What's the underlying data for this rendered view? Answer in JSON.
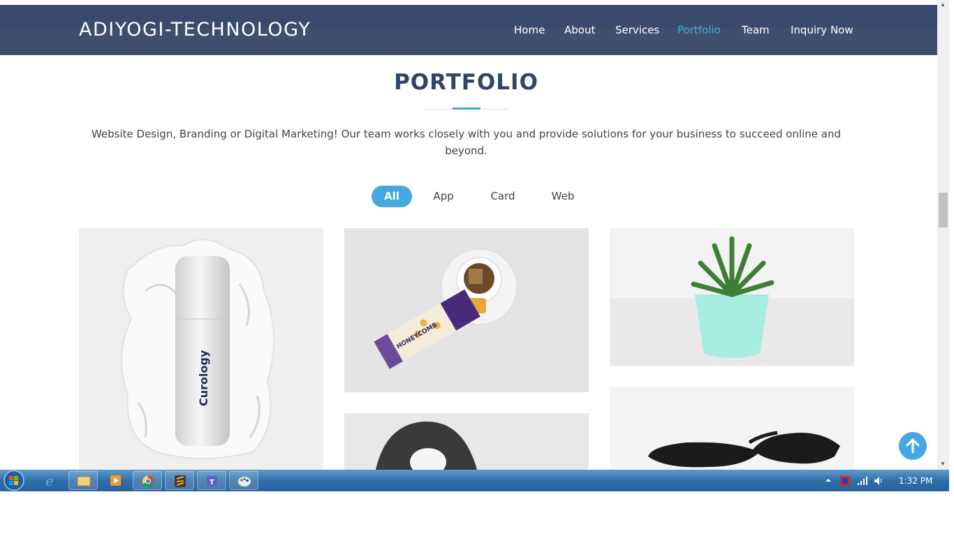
{
  "brand": "ADIYOGI-TECHNOLOGY",
  "nav": [
    {
      "label": "Home",
      "active": false
    },
    {
      "label": "About",
      "active": false
    },
    {
      "label": "Services",
      "active": false
    },
    {
      "label": "Portfolio",
      "active": true
    },
    {
      "label": "Team",
      "active": false
    },
    {
      "label": "Inquiry Now",
      "active": false
    }
  ],
  "section": {
    "title": "PORTFOLIO",
    "description": "Website Design, Branding or Digital Marketing! Our team works closely with you and provide solutions for your business to succeed online and beyond."
  },
  "filters": [
    {
      "label": "All",
      "active": true
    },
    {
      "label": "App",
      "active": false
    },
    {
      "label": "Card",
      "active": false
    },
    {
      "label": "Web",
      "active": false
    }
  ],
  "portfolio_items": [
    {
      "icon": "skincare-bottle-image",
      "text": "Curology"
    },
    {
      "icon": "honeycomb-tea-image",
      "text": "HONEYCOMB"
    },
    {
      "icon": "succulent-plant-image"
    },
    {
      "icon": "lamp-image"
    },
    {
      "icon": "sunglasses-image"
    }
  ],
  "colors": {
    "header": "#3f506f",
    "accent": "#46a8e0",
    "title": "#2f4468"
  },
  "taskbar": {
    "clock": "1:32 PM",
    "apps": [
      "start-orb-icon",
      "internet-explorer-icon",
      "file-explorer-icon",
      "media-player-icon",
      "chrome-icon",
      "sublime-text-icon",
      "teams-icon",
      "paint-icon"
    ],
    "tray_icons": [
      "show-hidden-icons-icon",
      "flag-icon",
      "network-signal-icon",
      "volume-icon"
    ]
  }
}
